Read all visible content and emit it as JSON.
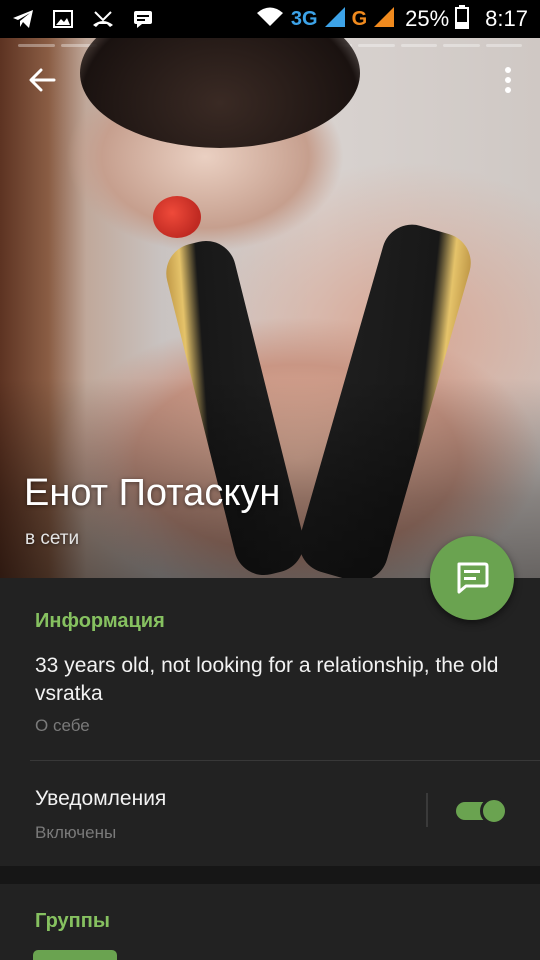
{
  "status_bar": {
    "icons_left": [
      "telegram-icon",
      "image-icon",
      "missed-call-icon",
      "chat-icon"
    ],
    "network_3g": "3G",
    "network_g": "G",
    "battery": "25%",
    "time": "8:17"
  },
  "story": {
    "segments": 12,
    "active_index": 5
  },
  "header": {
    "name": "Енот Потаскун",
    "status": "в сети"
  },
  "info": {
    "title": "Информация",
    "about_text": "33 years old, not looking for a relationship, the old vsratka",
    "about_label": "О себе"
  },
  "notifications": {
    "title": "Уведомления",
    "state_label": "Включены",
    "enabled": true
  },
  "groups": {
    "title": "Группы"
  },
  "colors": {
    "accent": "#86c160",
    "fab": "#6aa350",
    "background": "#222222"
  }
}
